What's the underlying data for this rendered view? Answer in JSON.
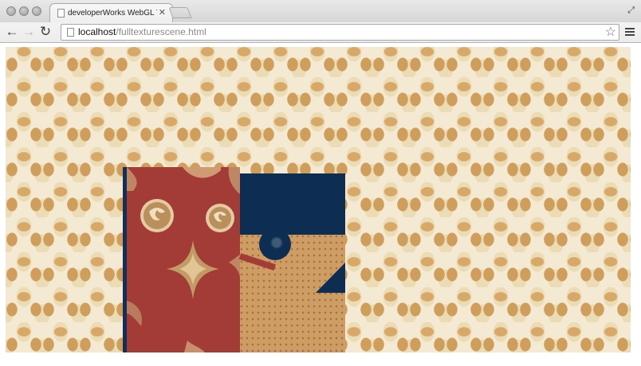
{
  "browser": {
    "tab": {
      "title": "developerWorks WebGL Th",
      "close_glyph": "✕",
      "page_icon": "page-icon"
    },
    "toolbar": {
      "back_glyph": "←",
      "forward_glyph": "→",
      "reload_glyph": "↻",
      "url_host": "localhost",
      "url_path": "/fulltexturescene.html",
      "star_glyph": "☆",
      "menu_icon": "hamburger-menu-icon"
    },
    "window_controls": [
      "close-light",
      "minimize-light",
      "zoom-light"
    ],
    "restore_glyph": "⤢"
  },
  "page": {
    "content": "webgl-canvas",
    "background_texture": "damask-wallpaper",
    "colors": {
      "wallpaper_cream": "#f4ead3",
      "wallpaper_tan": "#d8a869",
      "object_red": "#a33b37",
      "object_navy": "#0d2d52",
      "object_sand": "#cd9d63"
    }
  }
}
